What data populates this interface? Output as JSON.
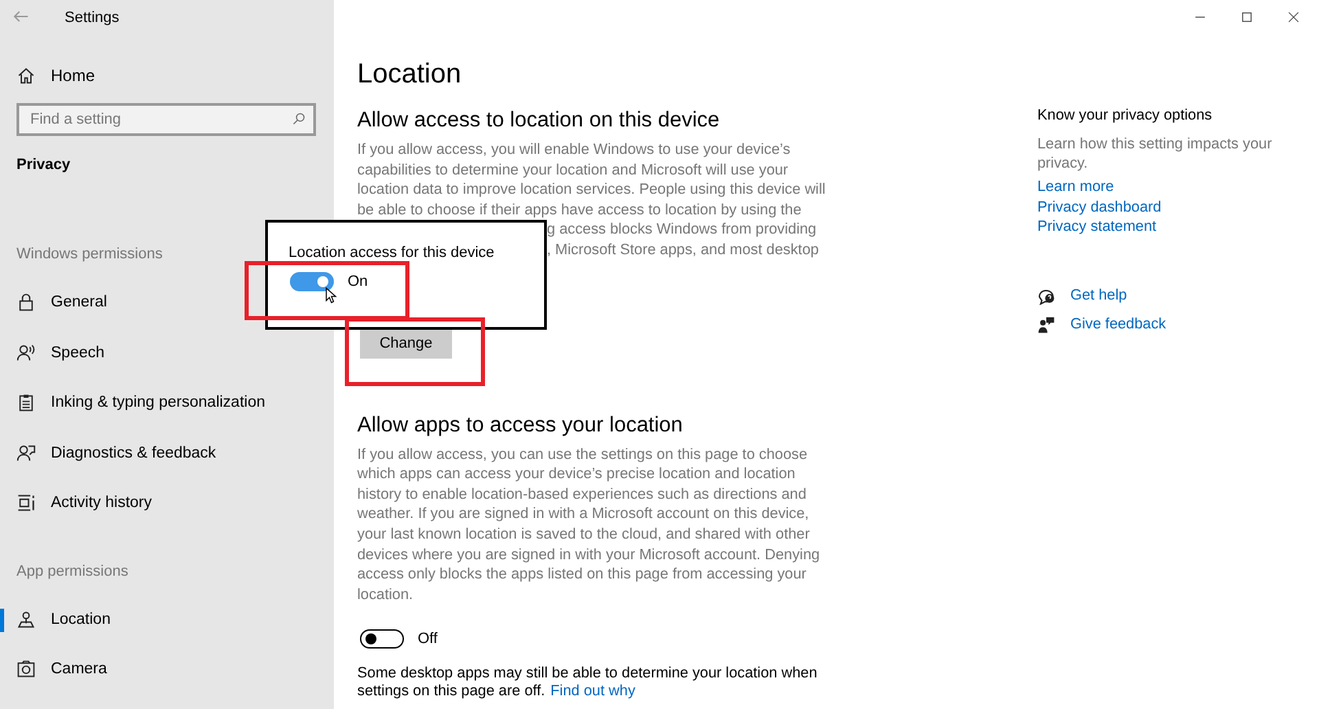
{
  "window": {
    "title": "Settings"
  },
  "sidebar": {
    "home": "Home",
    "search": {
      "placeholder": "Find a setting"
    },
    "category": "Privacy",
    "groups": [
      {
        "heading": "Windows permissions",
        "items": [
          {
            "label": "General",
            "selected": false
          },
          {
            "label": "Speech",
            "selected": false
          },
          {
            "label": "Inking & typing personalization",
            "selected": false
          },
          {
            "label": "Diagnostics & feedback",
            "selected": false
          },
          {
            "label": "Activity history",
            "selected": false
          }
        ]
      },
      {
        "heading": "App permissions",
        "items": [
          {
            "label": "Location",
            "selected": true
          },
          {
            "label": "Camera",
            "selected": false
          }
        ]
      }
    ]
  },
  "page": {
    "title": "Location",
    "sections": [
      {
        "heading": "Allow access to location on this device",
        "lines": [
          "If you allow access, you will enable Windows to use your device’s",
          "capabilities to determine your location and Microsoft will use your",
          "location data to improve location services. People using this device will",
          "be able to choose if their apps have access to location by using the"
        ],
        "fragments": [
          "g access blocks Windows from providing",
          ", Microsoft Store apps, and most desktop"
        ],
        "button": "Change"
      },
      {
        "heading": "Allow apps to access your location",
        "lines": [
          "If you allow access, you can use the settings on this page to choose",
          "which apps can access your device’s precise location and location",
          "history to enable location-based experiences such as directions and",
          "weather. If you are signed in with a Microsoft account on this device,",
          "your last known location is saved to the cloud, and shared with other",
          "devices where you are signed in with your Microsoft account. Denying",
          "access only blocks the apps listed on this page from accessing your",
          "location."
        ],
        "toggle": {
          "on": false,
          "label": "Off"
        },
        "note": "Some desktop apps may still be able to determine your location when",
        "note2": "settings on this page are off.",
        "note_link": "Find out why"
      }
    ]
  },
  "popup": {
    "title": "Location access for this device",
    "toggle": {
      "on": true,
      "label": "On"
    }
  },
  "aside": {
    "heading": "Know your privacy options",
    "text": "Learn how this setting impacts your privacy.",
    "links": [
      "Learn more",
      "Privacy dashboard",
      "Privacy statement"
    ],
    "help": [
      "Get help",
      "Give feedback"
    ]
  }
}
